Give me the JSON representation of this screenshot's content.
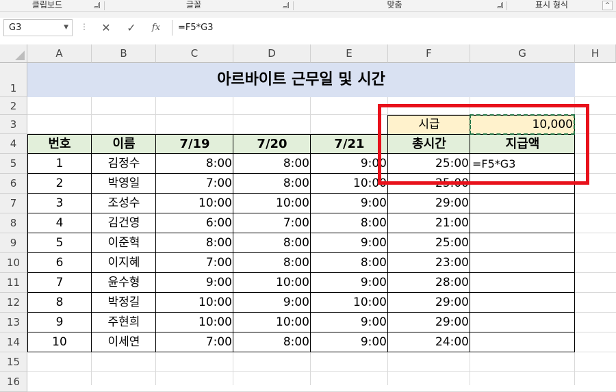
{
  "ribbon": {
    "groups": [
      "클립보드",
      "글꼴",
      "맞춤",
      "표시 형식"
    ],
    "collapse_icon": "^"
  },
  "formula_bar": {
    "name_box": "G3",
    "cancel_icon": "✕",
    "enter_icon": "✓",
    "fx_label": "fx",
    "formula": "=F5*G3"
  },
  "columns": [
    "A",
    "B",
    "C",
    "D",
    "E",
    "F",
    "G",
    "H"
  ],
  "rows": [
    "1",
    "2",
    "3",
    "4",
    "5",
    "6",
    "7",
    "8",
    "9",
    "10",
    "11",
    "12",
    "13",
    "14",
    "15",
    "16"
  ],
  "sheet": {
    "title": "아르바이트 근무일 및 시간",
    "wage_label": "시급",
    "wage_value": "10,000",
    "headers": [
      "번호",
      "이름",
      "7/19",
      "7/20",
      "7/21",
      "총시간",
      "지급액"
    ],
    "editing_cell": "=F5*G3",
    "records": [
      [
        "1",
        "김정수",
        "8:00",
        "8:00",
        "9:00",
        "25:00"
      ],
      [
        "2",
        "박영일",
        "7:00",
        "8:00",
        "10:00",
        "25:00"
      ],
      [
        "3",
        "조성수",
        "10:00",
        "10:00",
        "9:00",
        "29:00"
      ],
      [
        "4",
        "김건영",
        "6:00",
        "7:00",
        "8:00",
        "21:00"
      ],
      [
        "5",
        "이준혁",
        "8:00",
        "8:00",
        "9:00",
        "25:00"
      ],
      [
        "6",
        "이지혜",
        "7:00",
        "8:00",
        "8:00",
        "23:00"
      ],
      [
        "7",
        "윤수형",
        "9:00",
        "10:00",
        "9:00",
        "28:00"
      ],
      [
        "8",
        "박정길",
        "10:00",
        "9:00",
        "10:00",
        "29:00"
      ],
      [
        "9",
        "주현희",
        "10:00",
        "10:00",
        "9:00",
        "29:00"
      ],
      [
        "10",
        "이세연",
        "7:00",
        "8:00",
        "9:00",
        "24:00"
      ]
    ]
  },
  "colors": {
    "title_fill": "#d9e1f2",
    "header_fill": "#e2efda",
    "wage_fill": "#fff2cc",
    "highlight_box": "#e8111b",
    "copy_marquee": "#217346"
  }
}
